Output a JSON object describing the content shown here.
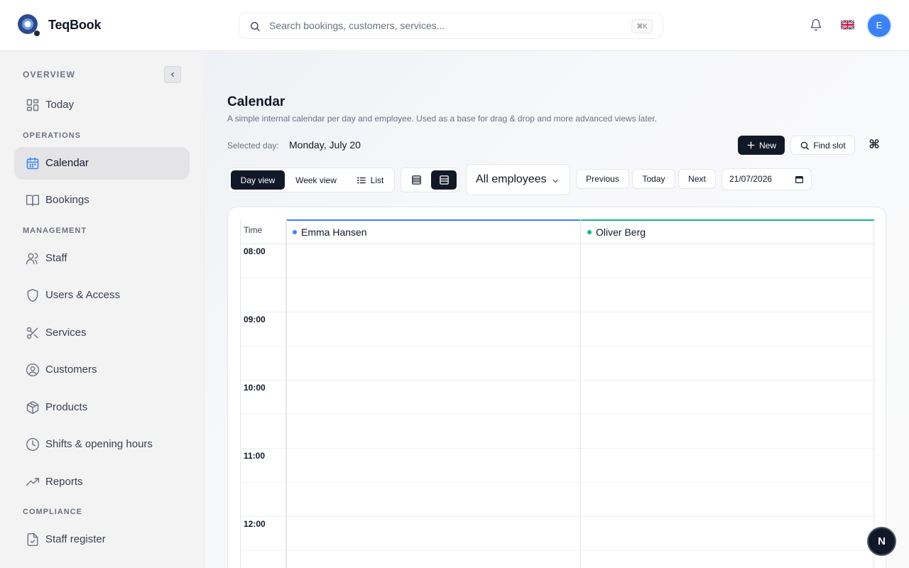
{
  "app": {
    "brand": "TeqBook"
  },
  "search": {
    "placeholder": "Search bookings, customers, services...",
    "shortcut": "⌘K"
  },
  "user": {
    "avatar_initial": "E"
  },
  "sidebar": {
    "sections": {
      "overview": "OVERVIEW",
      "operations": "OPERATIONS",
      "management": "MANAGEMENT",
      "compliance": "COMPLIANCE"
    },
    "items": [
      {
        "label": "Today",
        "icon": "dashboard-icon"
      },
      {
        "label": "Calendar",
        "icon": "calendar-icon",
        "active": true
      },
      {
        "label": "Bookings",
        "icon": "book-icon"
      },
      {
        "label": "Staff",
        "icon": "users-icon"
      },
      {
        "label": "Users & Access",
        "icon": "shield-icon"
      },
      {
        "label": "Services",
        "icon": "scissors-icon"
      },
      {
        "label": "Customers",
        "icon": "user-circle-icon"
      },
      {
        "label": "Products",
        "icon": "package-icon"
      },
      {
        "label": "Shifts & opening hours",
        "icon": "clock-icon"
      },
      {
        "label": "Reports",
        "icon": "trending-up-icon"
      },
      {
        "label": "Staff register",
        "icon": "file-check-icon"
      }
    ]
  },
  "page": {
    "title": "Calendar",
    "description": "A simple internal calendar per day and employee. Used as a base for drag & drop and more advanced views later.",
    "selected_day_label": "Selected day:",
    "selected_day_value": "Monday, July 20"
  },
  "toolbar": {
    "new_label": "New",
    "find_slot_label": "Find slot",
    "cmd_symbol": "⌘",
    "views": {
      "day": "Day view",
      "week": "Week view",
      "list": "List"
    },
    "employee_filter": "All employees",
    "previous": "Previous",
    "today": "Today",
    "next": "Next",
    "date_value": "21/07/2026"
  },
  "calendar": {
    "time_header": "Time",
    "employees": [
      {
        "name": "Emma Hansen",
        "color": "#3b82f6"
      },
      {
        "name": "Oliver Berg",
        "color": "#10b981"
      }
    ],
    "hours": [
      "08:00",
      "09:00",
      "10:00",
      "11:00",
      "12:00"
    ]
  },
  "fab": {
    "label": "N"
  }
}
